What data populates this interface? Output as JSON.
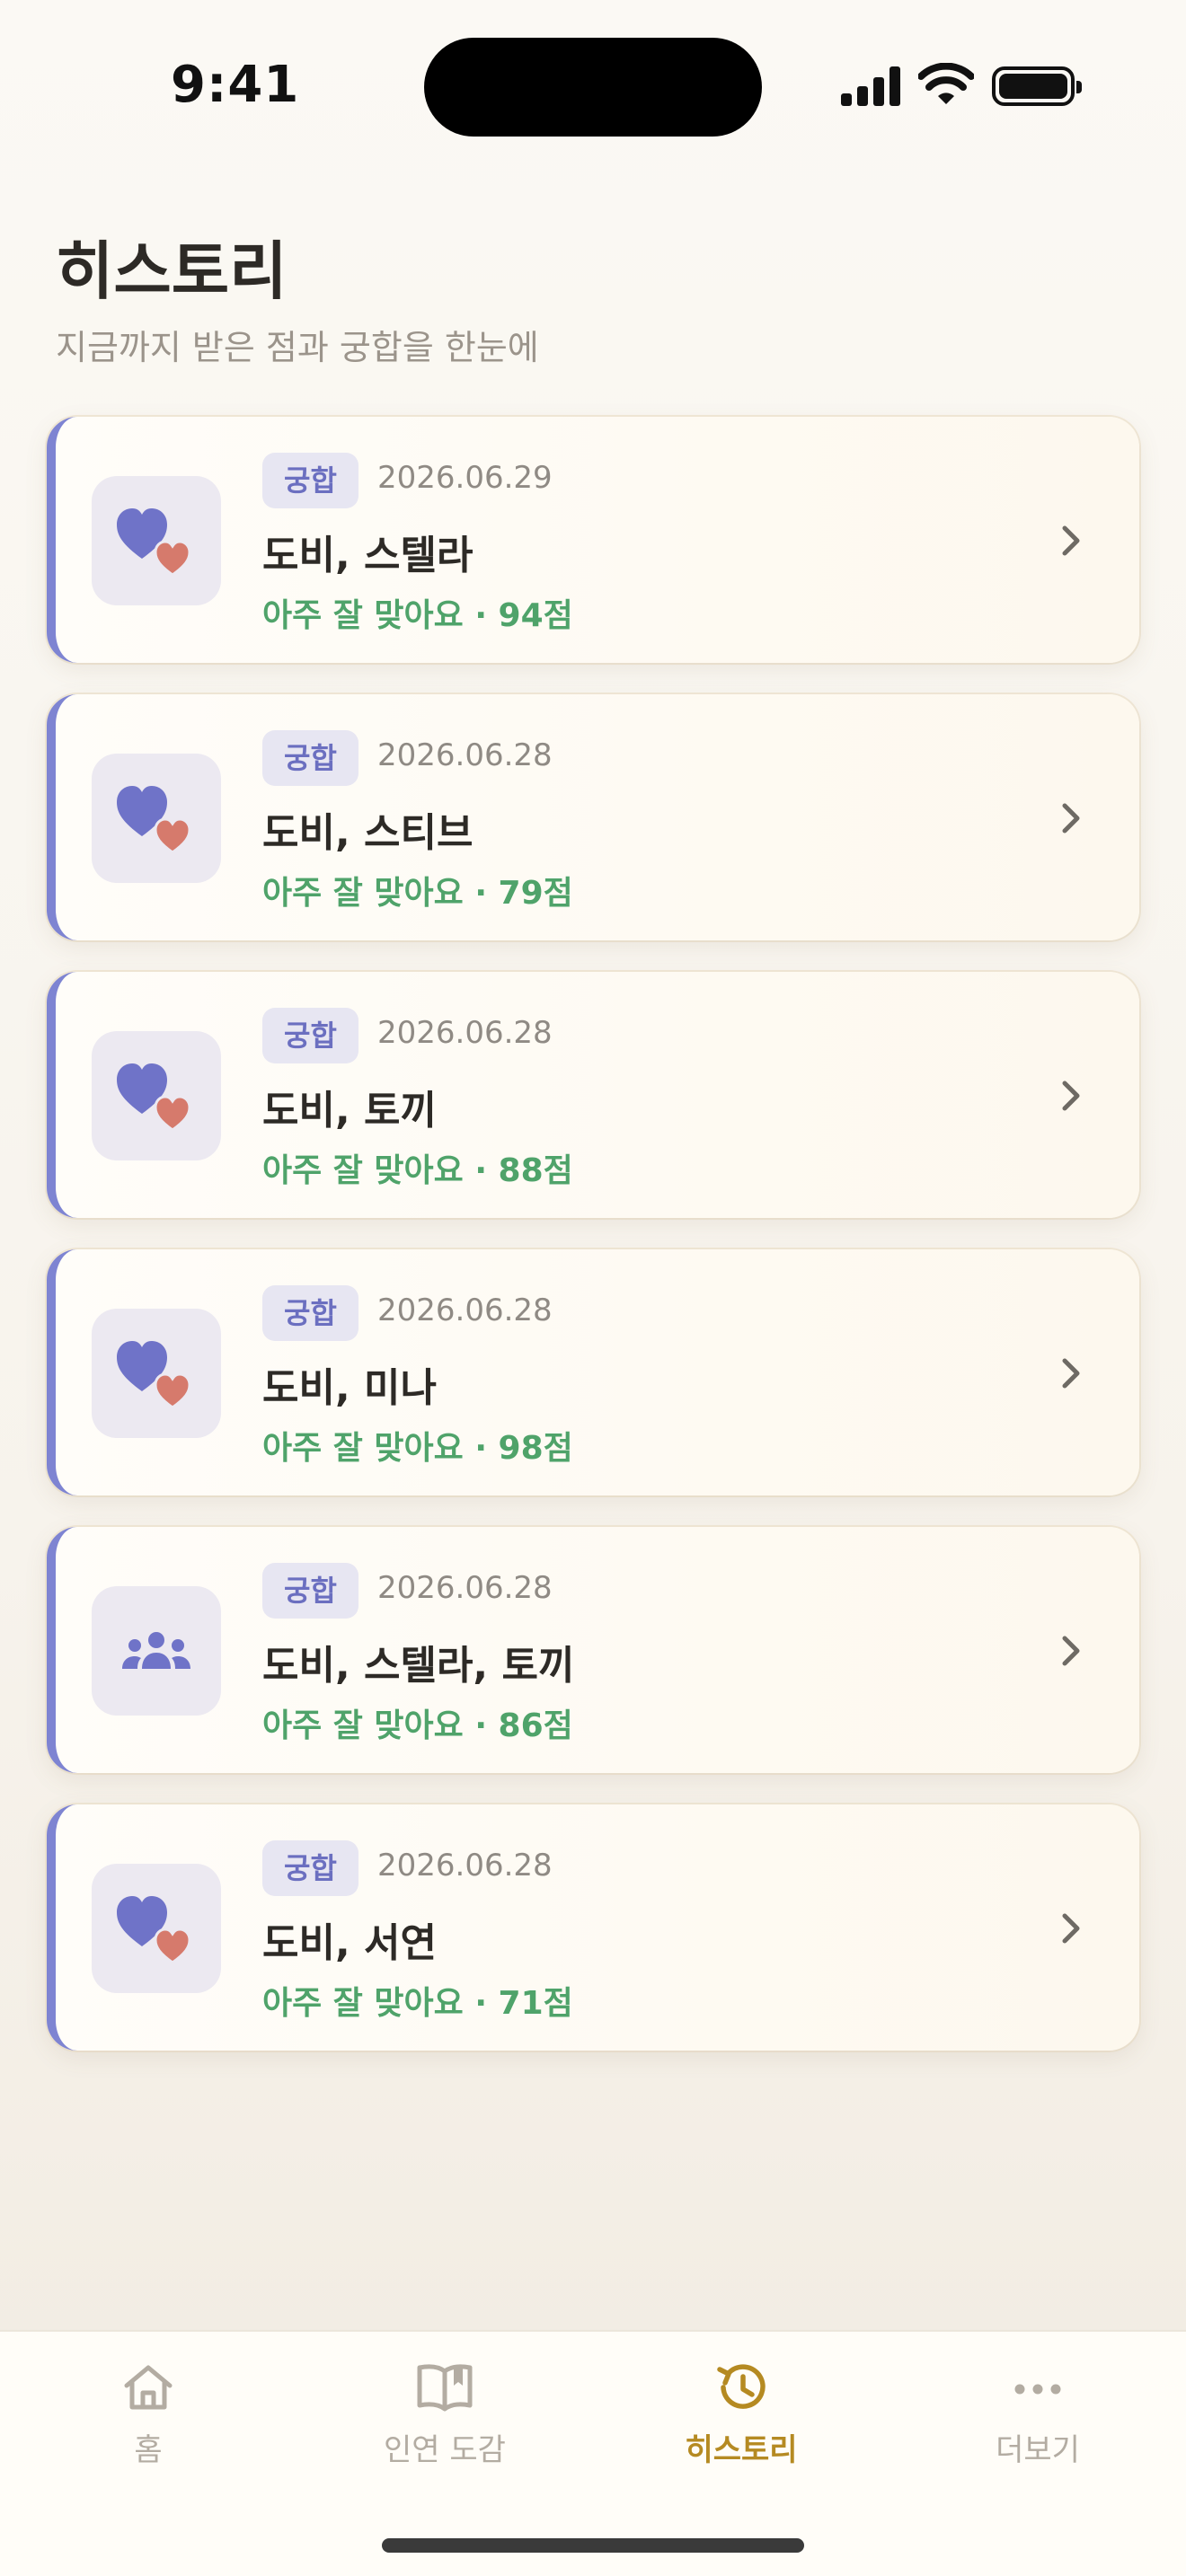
{
  "status_bar": {
    "time": "9:41"
  },
  "header": {
    "title": "히스토리",
    "subtitle": "지금까지 받은 점과 궁합을 한눈에"
  },
  "history": [
    {
      "badge": "궁합",
      "date": "2026.06.29",
      "names": "도비, 스텔라",
      "result": "아주 잘 맞아요 · 94점",
      "icon": "hearts-icon"
    },
    {
      "badge": "궁합",
      "date": "2026.06.28",
      "names": "도비, 스티브",
      "result": "아주 잘 맞아요 · 79점",
      "icon": "hearts-icon"
    },
    {
      "badge": "궁합",
      "date": "2026.06.28",
      "names": "도비, 토끼",
      "result": "아주 잘 맞아요 · 88점",
      "icon": "hearts-icon"
    },
    {
      "badge": "궁합",
      "date": "2026.06.28",
      "names": "도비, 미나",
      "result": "아주 잘 맞아요 · 98점",
      "icon": "hearts-icon"
    },
    {
      "badge": "궁합",
      "date": "2026.06.28",
      "names": "도비, 스텔라, 토끼",
      "result": "아주 잘 맞아요 · 86점",
      "icon": "group-icon"
    },
    {
      "badge": "궁합",
      "date": "2026.06.28",
      "names": "도비, 서연",
      "result": "아주 잘 맞아요 · 71점",
      "icon": "hearts-icon"
    }
  ],
  "tabs": [
    {
      "label": "홈",
      "icon": "home-icon",
      "active": false
    },
    {
      "label": "인연 도감",
      "icon": "book-icon",
      "active": false
    },
    {
      "label": "히스토리",
      "icon": "history-icon",
      "active": true
    },
    {
      "label": "더보기",
      "icon": "more-icon",
      "active": false
    }
  ],
  "colors": {
    "accent_bar": "#7e84d2",
    "badge_text": "#6b6fc0",
    "result_green": "#4fa36a",
    "heart_purple": "#6f73c8",
    "heart_coral": "#d67a6c",
    "tab_active": "#b58a22",
    "tab_inactive": "#b3aca2"
  }
}
